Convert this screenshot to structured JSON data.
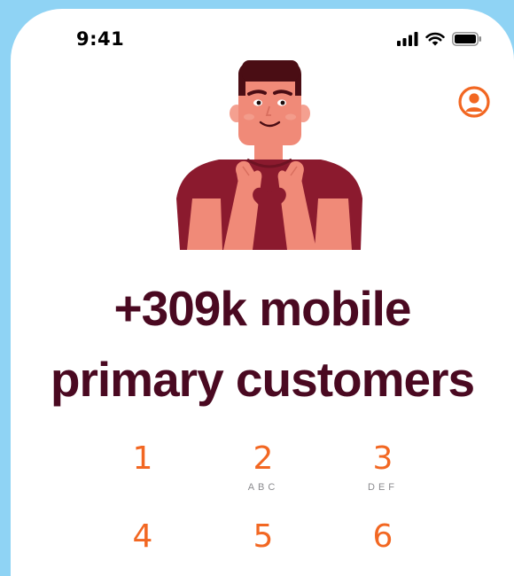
{
  "status_bar": {
    "time": "9:41",
    "icons": [
      "cellular-signal-icon",
      "wifi-icon",
      "battery-icon"
    ]
  },
  "header": {
    "profile_icon": "user-circle-icon"
  },
  "hero": {
    "illustration": "person-heart-hands-illustration"
  },
  "headline": {
    "line1": "+309k mobile",
    "line2": "primary customers"
  },
  "keypad": {
    "keys": [
      {
        "digit": "1",
        "letters": ""
      },
      {
        "digit": "2",
        "letters": "ABC"
      },
      {
        "digit": "3",
        "letters": "DEF"
      },
      {
        "digit": "4",
        "letters": ""
      },
      {
        "digit": "5",
        "letters": ""
      },
      {
        "digit": "6",
        "letters": ""
      }
    ]
  },
  "colors": {
    "background": "#8fd3f4",
    "accent": "#f26722",
    "headline": "#4a0921",
    "shirt": "#8b1a2e",
    "skin": "#f08a78"
  }
}
